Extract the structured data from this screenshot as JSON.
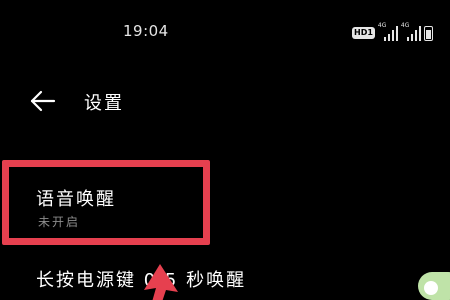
{
  "status_bar": {
    "time": "19:04",
    "hd_badge": "HD1",
    "network_1": "4G",
    "network_2": "4G",
    "icons": [
      "hd-icon",
      "signal-icon",
      "signal-icon",
      "battery-icon"
    ]
  },
  "header": {
    "back_icon": "back-arrow-icon",
    "title": "设置"
  },
  "settings": {
    "voice_wake": {
      "title": "语音唤醒",
      "status": "未开启"
    },
    "power_button_wake": {
      "title": "长按电源键 0.5 秒唤醒",
      "toggle_state": "on"
    }
  },
  "annotations": {
    "highlight_color": "#e6404f",
    "highlighted_item": "voice_wake",
    "pointer_icon": "red-pointer-arrow-icon"
  },
  "colors": {
    "background": "#000000",
    "text_primary": "#ffffff",
    "text_secondary": "#8c8c8c",
    "toggle_on": "#bfe3a8"
  }
}
